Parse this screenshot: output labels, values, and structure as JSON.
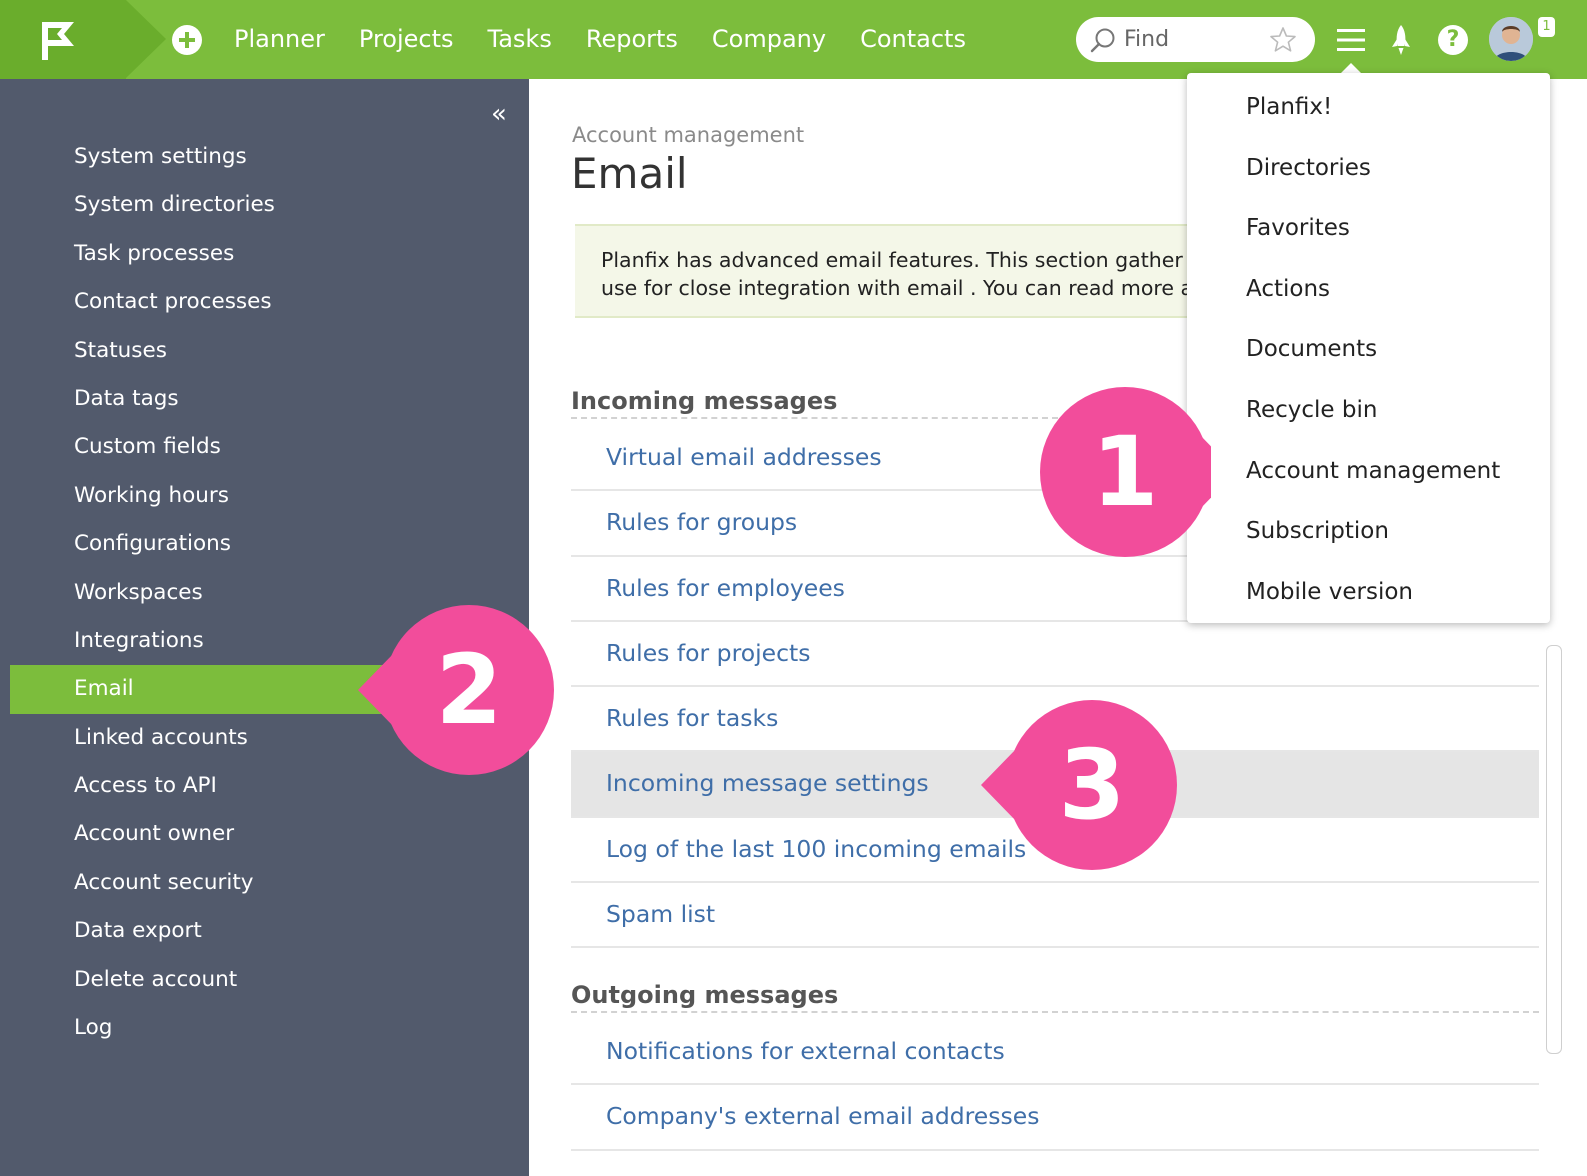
{
  "topbar": {
    "nav": [
      "Planner",
      "Projects",
      "Tasks",
      "Reports",
      "Company",
      "Contacts"
    ],
    "search_placeholder": "Find",
    "help_label": "?",
    "notification_count": "1"
  },
  "sidebar": {
    "items": [
      {
        "label": "System settings"
      },
      {
        "label": "System directories"
      },
      {
        "label": "Task processes"
      },
      {
        "label": "Contact processes"
      },
      {
        "label": "Statuses"
      },
      {
        "label": "Data tags"
      },
      {
        "label": "Custom fields"
      },
      {
        "label": "Working hours"
      },
      {
        "label": "Configurations"
      },
      {
        "label": "Workspaces"
      },
      {
        "label": "Integrations"
      },
      {
        "label": "Email",
        "active": true
      },
      {
        "label": "Linked accounts"
      },
      {
        "label": "Access to API"
      },
      {
        "label": "Account owner"
      },
      {
        "label": "Account security"
      },
      {
        "label": "Data export"
      },
      {
        "label": "Delete account"
      },
      {
        "label": "Log"
      }
    ]
  },
  "content": {
    "breadcrumb": "Account management",
    "title": "Email",
    "info_line1": "Planfix has advanced email features. This section gather",
    "info_line2": "use for close integration with email . You can read more a",
    "incoming": {
      "title": "Incoming messages",
      "links": [
        "Virtual email addresses",
        "Rules for groups",
        "Rules for employees",
        "Rules for projects",
        "Rules for tasks",
        "Incoming message settings",
        "Log of the last 100 incoming emails",
        "Spam list"
      ],
      "highlighted_index": 5
    },
    "outgoing": {
      "title": "Outgoing messages",
      "links": [
        "Notifications for external contacts",
        "Company's external email addresses"
      ]
    }
  },
  "dropdown": {
    "items": [
      "Planfix!",
      "Directories",
      "Favorites",
      "Actions",
      "Documents",
      "Recycle bin",
      "Account management",
      "Subscription",
      "Mobile version"
    ]
  },
  "callouts": {
    "one": "1",
    "two": "2",
    "three": "3",
    "color": "#f24d9b"
  },
  "colors": {
    "accent_green": "#7cbd3c",
    "sidebar_bg": "#525a6c",
    "link_blue": "#3f6ea8"
  }
}
